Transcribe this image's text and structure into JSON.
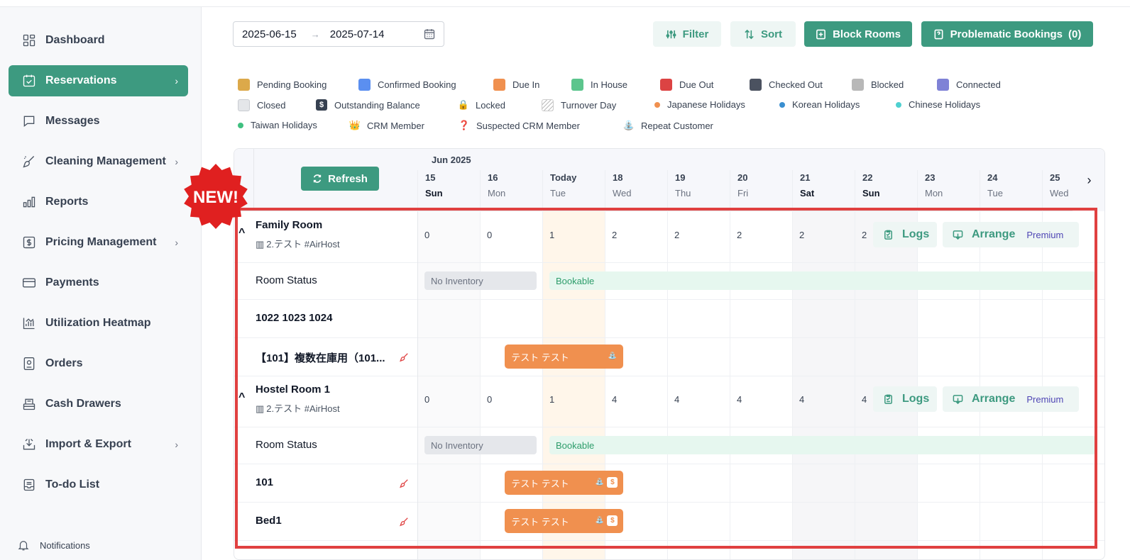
{
  "sidebar": {
    "items": [
      {
        "label": "Dashboard",
        "icon": "dashboard-icon",
        "chevron": false,
        "active": false
      },
      {
        "label": "Reservations",
        "icon": "calendar-icon",
        "chevron": true,
        "active": true
      },
      {
        "label": "Messages",
        "icon": "message-icon",
        "chevron": false,
        "active": false
      },
      {
        "label": "Cleaning Management",
        "icon": "broom-icon",
        "chevron": true,
        "active": false
      },
      {
        "label": "Reports",
        "icon": "bar-chart-icon",
        "chevron": false,
        "active": false
      },
      {
        "label": "Pricing Management",
        "icon": "dollar-icon",
        "chevron": true,
        "active": false
      },
      {
        "label": "Payments",
        "icon": "card-icon",
        "chevron": false,
        "active": false
      },
      {
        "label": "Utilization Heatmap",
        "icon": "heatmap-icon",
        "chevron": false,
        "active": false
      },
      {
        "label": "Orders",
        "icon": "orders-icon",
        "chevron": false,
        "active": false
      },
      {
        "label": "Cash Drawers",
        "icon": "cash-drawer-icon",
        "chevron": false,
        "active": false
      },
      {
        "label": "Import & Export",
        "icon": "import-export-icon",
        "chevron": true,
        "active": false
      },
      {
        "label": "To-do List",
        "icon": "todo-icon",
        "chevron": false,
        "active": false
      }
    ],
    "chevron_glyph": "›",
    "notifications_label": "Notifications"
  },
  "toolbar": {
    "date_start": "2025-06-15",
    "date_arrow": "→",
    "date_end": "2025-07-14",
    "filter_label": "Filter",
    "sort_label": "Sort",
    "block_rooms_label": "Block Rooms",
    "problematic_label": "Problematic Bookings",
    "problematic_count": "(0)"
  },
  "colors": {
    "accent": "#3d9a80",
    "booking": "#f0904f",
    "highlight": "#e04040"
  },
  "legend": [
    {
      "label": "Pending Booking",
      "kind": "swatch",
      "color": "#dca94a"
    },
    {
      "label": "Confirmed Booking",
      "kind": "swatch",
      "color": "#5b8ff0"
    },
    {
      "label": "Due In",
      "kind": "swatch",
      "color": "#f0904f"
    },
    {
      "label": "In House",
      "kind": "swatch",
      "color": "#5cc58d"
    },
    {
      "label": "Due Out",
      "kind": "swatch",
      "color": "#dc4343"
    },
    {
      "label": "Checked Out",
      "kind": "swatch",
      "color": "#4b5260"
    },
    {
      "label": "Blocked",
      "kind": "swatch",
      "color": "#b8b8b8"
    },
    {
      "label": "Connected",
      "kind": "swatch",
      "color": "#7f82d6"
    },
    {
      "label": "Closed",
      "kind": "swatch",
      "color": "#e4e6e9"
    },
    {
      "label": "Outstanding Balance",
      "kind": "icon",
      "glyph": "$",
      "icon": "dollar-badge-icon"
    },
    {
      "label": "Locked",
      "kind": "icon",
      "glyph": "🔒",
      "icon": "lock-icon"
    },
    {
      "label": "Turnover Day",
      "kind": "hatch"
    },
    {
      "label": "Japanese Holidays",
      "kind": "dot",
      "color": "#f0904f"
    },
    {
      "label": "Korean Holidays",
      "kind": "dot",
      "color": "#3a8fd0"
    },
    {
      "label": "Chinese Holidays",
      "kind": "dot",
      "color": "#4fd0d0"
    },
    {
      "label": "Taiwan Holidays",
      "kind": "dot",
      "color": "#40c080"
    },
    {
      "label": "CRM Member",
      "kind": "icon",
      "glyph": "👑",
      "icon": "crown-icon"
    },
    {
      "label": "Suspected CRM Member",
      "kind": "icon",
      "glyph": "❓",
      "icon": "suspected-crown-icon"
    },
    {
      "label": "Repeat Customer",
      "kind": "icon",
      "glyph": "⛲",
      "icon": "repeat-customer-icon"
    }
  ],
  "calendar": {
    "refresh_label": "Refresh",
    "month_label": "Jun 2025",
    "next_glyph": "›",
    "days": [
      {
        "num": "15",
        "name": "Sun",
        "bold": true
      },
      {
        "num": "16",
        "name": "Mon",
        "bold": false
      },
      {
        "num": "Today",
        "name": "Tue",
        "bold": false
      },
      {
        "num": "18",
        "name": "Wed",
        "bold": false
      },
      {
        "num": "19",
        "name": "Thu",
        "bold": false
      },
      {
        "num": "20",
        "name": "Fri",
        "bold": false
      },
      {
        "num": "21",
        "name": "Sat",
        "bold": true
      },
      {
        "num": "22",
        "name": "Sun",
        "bold": true
      },
      {
        "num": "23",
        "name": "Mon",
        "bold": false
      },
      {
        "num": "24",
        "name": "Tue",
        "bold": false
      },
      {
        "num": "25",
        "name": "Wed",
        "bold": false
      }
    ],
    "rooms": [
      {
        "name": "Family Room",
        "property": "2.テスト #AirHost",
        "counts": [
          "0",
          "0",
          "1",
          "2",
          "2",
          "2",
          "2",
          "2"
        ],
        "status_label": "Room Status",
        "no_inventory": "No Inventory",
        "bookable": "Bookable",
        "logs_label": "Logs",
        "arrange_label": "Arrange",
        "premium_label": "Premium",
        "units": [
          {
            "name": "1022 1023 1024",
            "bold": true,
            "broom": false,
            "booking": null
          },
          {
            "name": "【101】複数在庫用（101...",
            "bold": true,
            "broom": true,
            "booking": {
              "guest": "テスト テスト",
              "start_day": 1.4,
              "nights": 1.9,
              "icons": [
                "⛲"
              ]
            }
          }
        ]
      },
      {
        "name": "Hostel Room 1",
        "property": "2.テスト #AirHost",
        "counts": [
          "0",
          "0",
          "1",
          "4",
          "4",
          "4",
          "4",
          "4"
        ],
        "status_label": "Room Status",
        "no_inventory": "No Inventory",
        "bookable": "Bookable",
        "logs_label": "Logs",
        "arrange_label": "Arrange",
        "premium_label": "Premium",
        "units": [
          {
            "name": "101",
            "bold": true,
            "broom": true,
            "booking": {
              "guest": "テスト テスト",
              "start_day": 1.4,
              "nights": 1.9,
              "icons": [
                "⛲",
                "$"
              ]
            }
          },
          {
            "name": "Bed1",
            "bold": true,
            "broom": true,
            "booking": {
              "guest": "テスト テスト",
              "start_day": 1.4,
              "nights": 1.9,
              "icons": [
                "⛲",
                "$"
              ]
            }
          }
        ]
      }
    ]
  },
  "badge": {
    "text": "NEW!"
  }
}
